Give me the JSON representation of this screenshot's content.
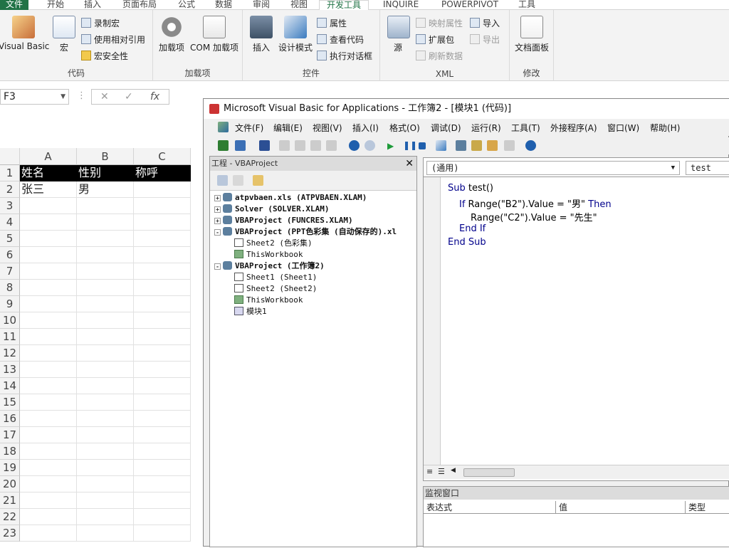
{
  "ribbon": {
    "tabs": [
      "文件",
      "开始",
      "插入",
      "页面布局",
      "公式",
      "数据",
      "审阅",
      "视图",
      "开发工具",
      "INQUIRE",
      "POWERPIVOT",
      "工具"
    ],
    "active_tab": "开发工具",
    "groups": {
      "code": {
        "label": "代码",
        "visual_basic": "Visual Basic",
        "macros": "宏",
        "record_macro": "录制宏",
        "relative_ref": "使用相对引用",
        "macro_security": "宏安全性"
      },
      "addins": {
        "label": "加载项",
        "addins": "加载项",
        "com_addins": "COM 加载项"
      },
      "controls": {
        "label": "控件",
        "insert": "插入",
        "design_mode": "设计模式",
        "properties": "属性",
        "view_code": "查看代码",
        "run_dialog": "执行对话框"
      },
      "xml": {
        "label": "XML",
        "source": "源",
        "map_props": "映射属性",
        "expansion": "扩展包",
        "refresh": "刷新数据",
        "import": "导入",
        "export": "导出"
      },
      "modify": {
        "label": "修改",
        "doc_panel": "文档面板"
      }
    }
  },
  "formula_bar": {
    "name_box": "F3",
    "dots": "⋮",
    "cancel": "✕",
    "enter": "✓",
    "fx": "fx",
    "value": ""
  },
  "sheet": {
    "columns": [
      "A",
      "B",
      "C"
    ],
    "rows": [
      "1",
      "2",
      "3",
      "4",
      "5",
      "6",
      "7",
      "8",
      "9",
      "10",
      "11",
      "12",
      "13",
      "14",
      "15",
      "16",
      "17",
      "18",
      "19",
      "20",
      "21",
      "22",
      "23"
    ],
    "cells": {
      "A1": "姓名",
      "B1": "性别",
      "C1": "称呼",
      "A2": "张三",
      "B2": "男",
      "C2": ""
    }
  },
  "vbe": {
    "title": "Microsoft Visual Basic for Applications - 工作簿2 - [模块1 (代码)]",
    "menu": [
      "文件(F)",
      "编辑(E)",
      "视图(V)",
      "插入(I)",
      "格式(O)",
      "调试(D)",
      "运行(R)",
      "工具(T)",
      "外接程序(A)",
      "窗口(W)",
      "帮助(H)"
    ],
    "project_title": "工程 - VBAProject",
    "tree": [
      {
        "label": "atpvbaen.xls (ATPVBAEN.XLAM)",
        "level": 0,
        "expander": "+",
        "kind": "project",
        "bold": true
      },
      {
        "label": "Solver (SOLVER.XLAM)",
        "level": 0,
        "expander": "+",
        "kind": "project",
        "bold": true
      },
      {
        "label": "VBAProject (FUNCRES.XLAM)",
        "level": 0,
        "expander": "+",
        "kind": "project",
        "bold": true
      },
      {
        "label": "VBAProject (PPT色彩集 (自动保存的).xl",
        "level": 0,
        "expander": "-",
        "kind": "project",
        "bold": true
      },
      {
        "label": "Sheet2 (色彩集)",
        "level": 1,
        "expander": "",
        "kind": "sheet",
        "bold": false
      },
      {
        "label": "ThisWorkbook",
        "level": 1,
        "expander": "",
        "kind": "workbook",
        "bold": false
      },
      {
        "label": "VBAProject (工作簿2)",
        "level": 0,
        "expander": "-",
        "kind": "project",
        "bold": true
      },
      {
        "label": "Sheet1 (Sheet1)",
        "level": 1,
        "expander": "",
        "kind": "sheet",
        "bold": false
      },
      {
        "label": "Sheet2 (Sheet2)",
        "level": 1,
        "expander": "",
        "kind": "sheet",
        "bold": false
      },
      {
        "label": "ThisWorkbook",
        "level": 1,
        "expander": "",
        "kind": "workbook",
        "bold": false
      },
      {
        "label": "模块1",
        "level": 1,
        "expander": "",
        "kind": "module",
        "bold": false
      }
    ],
    "code_object": "(通用)",
    "code_proc": "test",
    "code_lines": [
      {
        "indent": 0,
        "parts": [
          {
            "t": "Sub",
            "k": true
          },
          {
            "t": " test()",
            "k": false
          }
        ]
      },
      {
        "indent": 1,
        "parts": [
          {
            "t": "If",
            "k": true
          },
          {
            "t": " Range(\"B2\").Value = \"男\" ",
            "k": false
          },
          {
            "t": "Then",
            "k": true
          }
        ]
      },
      {
        "indent": 2,
        "parts": [
          {
            "t": "Range(\"C2\").Value = \"先生\"",
            "k": false
          }
        ]
      },
      {
        "indent": 1,
        "parts": [
          {
            "t": "End If",
            "k": true
          }
        ]
      },
      {
        "indent": 0,
        "parts": [
          {
            "t": "End Sub",
            "k": true
          }
        ]
      }
    ],
    "watch_title": "监视窗口",
    "watch_cols": [
      "表达式",
      "值",
      "类型"
    ]
  },
  "colors": {
    "excel_green": "#217346",
    "keyword_blue": "#00008b",
    "header_row_bg": "#000000"
  }
}
